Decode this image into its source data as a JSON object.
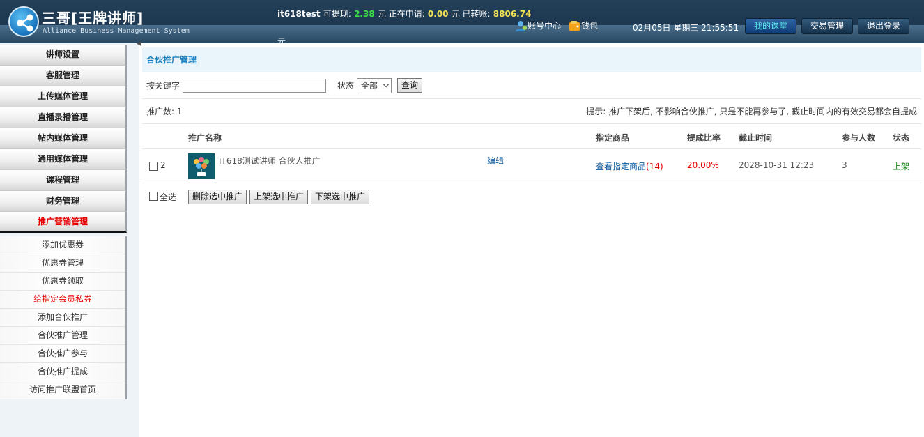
{
  "header": {
    "title": "三哥[王牌讲师]",
    "subtitle": "Alliance Business Management System",
    "user": "it618test",
    "withdrawable_label": "可提现:",
    "withdrawable": "2.38",
    "applying_label": "元 正在申请:",
    "applying": "0.00",
    "transferred_label": "元 已转账:",
    "transferred": "8806.74",
    "unit": "元",
    "account_link": "账号中心",
    "wallet_link": "钱包",
    "datetime": "02月05日 星期三 21:55:51",
    "buttons": {
      "my_class": "我的课堂",
      "trade": "交易管理",
      "logout": "退出登录"
    }
  },
  "sidebar": {
    "items": [
      {
        "label": "讲师设置"
      },
      {
        "label": "客服管理"
      },
      {
        "label": "上传媒体管理"
      },
      {
        "label": "直播录播管理"
      },
      {
        "label": "帖内媒体管理"
      },
      {
        "label": "通用媒体管理"
      },
      {
        "label": "课程管理"
      },
      {
        "label": "财务管理"
      },
      {
        "label": "推广营销管理"
      }
    ],
    "sub_items": [
      {
        "label": "添加优惠券"
      },
      {
        "label": "优惠券管理"
      },
      {
        "label": "优惠券领取"
      },
      {
        "label": "给指定会员私券"
      },
      {
        "label": "添加合伙推广"
      },
      {
        "label": "合伙推广管理"
      },
      {
        "label": "合伙推广参与"
      },
      {
        "label": "合伙推广提成"
      },
      {
        "label": "访问推广联盟首页"
      }
    ]
  },
  "main": {
    "panel_title": "合伙推广管理",
    "search": {
      "keyword_label": "按关键字",
      "keyword_value": "",
      "status_label": "状态",
      "status_selected": "全部",
      "query_button": "查询"
    },
    "count_text": "推广数: 1",
    "hint": "提示: 推广下架后, 不影响合伙推广, 只是不能再参与了, 截止时间内的有效交易都会自提成",
    "table": {
      "headers": {
        "name": "推广名称",
        "goods": "指定商品",
        "rate": "提成比率",
        "deadline": "截止时间",
        "joined": "参与人数",
        "status": "状态"
      },
      "rows": [
        {
          "id": "2",
          "name": "IT618测试讲师 合伙人推广",
          "edit": "编辑",
          "goods_link": "查看指定商品",
          "goods_count": "(14)",
          "rate": "20.00%",
          "deadline": "2028-10-31 12:23",
          "joined": "3",
          "status": "上架"
        }
      ]
    },
    "bulk": {
      "select_all": "全选",
      "delete": "删除选中推广",
      "publish": "上架选中推广",
      "unpublish": "下架选中推广"
    }
  }
}
